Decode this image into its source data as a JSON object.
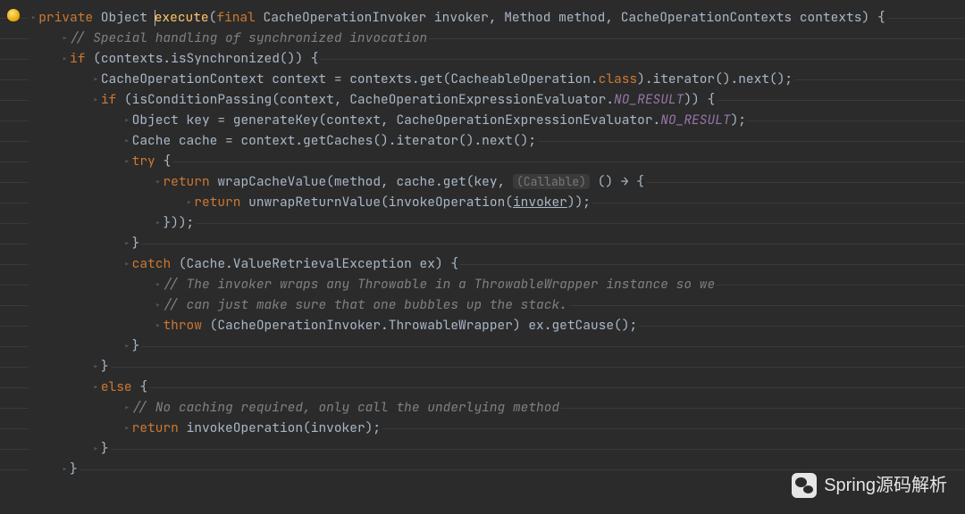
{
  "watermark": "Spring源码解析",
  "lines": [
    {
      "indent": 0,
      "tokens": [
        [
          "kw",
          "private"
        ],
        [
          "plain",
          " Object "
        ],
        [
          "cursor",
          ""
        ],
        [
          "method",
          "execute"
        ],
        [
          "plain",
          "("
        ],
        [
          "kw",
          "final"
        ],
        [
          "plain",
          " CacheOperationInvoker invoker, Method method, CacheOperationContexts contexts) {"
        ]
      ]
    },
    {
      "indent": 1,
      "tokens": [
        [
          "cmt",
          "// Special handling of synchronized invocation"
        ]
      ]
    },
    {
      "indent": 1,
      "tokens": [
        [
          "kw",
          "if"
        ],
        [
          "plain",
          " (contexts.isSynchronized()) {"
        ]
      ]
    },
    {
      "indent": 2,
      "tokens": [
        [
          "plain",
          "CacheOperationContext context = contexts.get(CacheableOperation."
        ],
        [
          "kw",
          "class"
        ],
        [
          "plain",
          ").iterator().next();"
        ]
      ]
    },
    {
      "indent": 2,
      "tokens": [
        [
          "kw",
          "if"
        ],
        [
          "plain",
          " (isConditionPassing(context, CacheOperationExpressionEvaluator."
        ],
        [
          "static",
          "NO_RESULT"
        ],
        [
          "plain",
          ")) {"
        ]
      ]
    },
    {
      "indent": 3,
      "tokens": [
        [
          "plain",
          "Object key = generateKey(context, CacheOperationExpressionEvaluator."
        ],
        [
          "static",
          "NO_RESULT"
        ],
        [
          "plain",
          ");"
        ]
      ]
    },
    {
      "indent": 3,
      "tokens": [
        [
          "plain",
          "Cache cache = context.getCaches().iterator().next();"
        ]
      ]
    },
    {
      "indent": 3,
      "tokens": [
        [
          "kw",
          "try"
        ],
        [
          "plain",
          " {"
        ]
      ]
    },
    {
      "indent": 4,
      "tokens": [
        [
          "kw",
          "return"
        ],
        [
          "plain",
          " wrapCacheValue(method, cache.get(key, "
        ],
        [
          "param-hint",
          "(Callable)"
        ],
        [
          "plain",
          " () → {"
        ]
      ]
    },
    {
      "indent": 5,
      "tokens": [
        [
          "kw",
          "return"
        ],
        [
          "plain",
          " unwrapReturnValue(invokeOperation("
        ],
        [
          "underline",
          "invoker"
        ],
        [
          "plain",
          "));"
        ]
      ]
    },
    {
      "indent": 4,
      "tokens": [
        [
          "plain",
          "}));"
        ]
      ]
    },
    {
      "indent": 3,
      "tokens": [
        [
          "plain",
          "}"
        ]
      ]
    },
    {
      "indent": 3,
      "tokens": [
        [
          "kw",
          "catch"
        ],
        [
          "plain",
          " (Cache.ValueRetrievalException ex) {"
        ]
      ]
    },
    {
      "indent": 4,
      "tokens": [
        [
          "cmt",
          "// The invoker wraps any Throwable in a ThrowableWrapper instance so we"
        ]
      ]
    },
    {
      "indent": 4,
      "tokens": [
        [
          "cmt",
          "// can just make sure that one bubbles up the stack."
        ]
      ]
    },
    {
      "indent": 4,
      "tokens": [
        [
          "kw",
          "throw"
        ],
        [
          "plain",
          " (CacheOperationInvoker.ThrowableWrapper) ex.getCause();"
        ]
      ]
    },
    {
      "indent": 3,
      "tokens": [
        [
          "plain",
          "}"
        ]
      ]
    },
    {
      "indent": 2,
      "tokens": [
        [
          "plain",
          "}"
        ]
      ]
    },
    {
      "indent": 2,
      "tokens": [
        [
          "kw",
          "else"
        ],
        [
          "plain",
          " {"
        ]
      ]
    },
    {
      "indent": 3,
      "tokens": [
        [
          "cmt",
          "// No caching required, only call the underlying method"
        ]
      ]
    },
    {
      "indent": 3,
      "tokens": [
        [
          "kw",
          "return"
        ],
        [
          "plain",
          " invokeOperation(invoker);"
        ]
      ]
    },
    {
      "indent": 2,
      "tokens": [
        [
          "plain",
          "}"
        ]
      ]
    },
    {
      "indent": 1,
      "tokens": [
        [
          "plain",
          "}"
        ]
      ]
    }
  ]
}
